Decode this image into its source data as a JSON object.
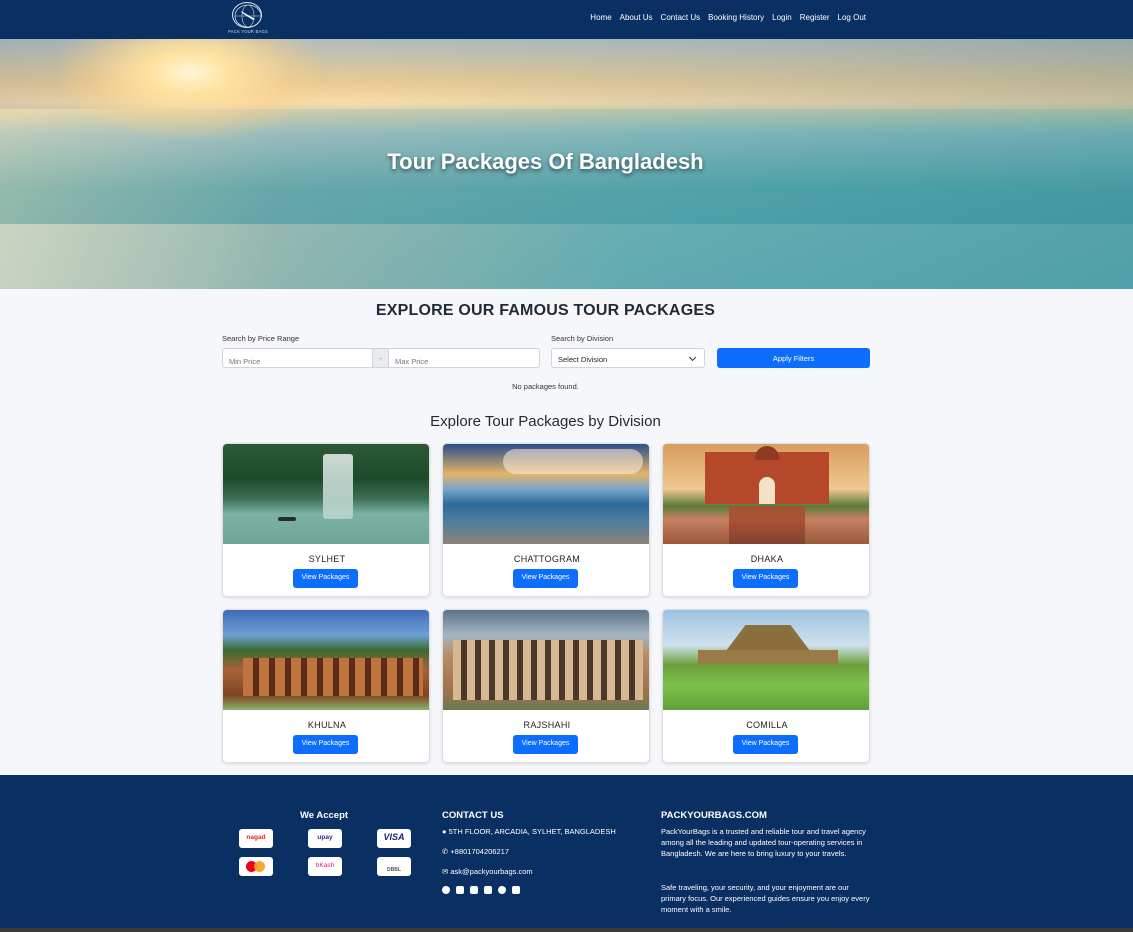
{
  "brand": {
    "logo_text": "PACK YOUR BAGS"
  },
  "nav": {
    "links": [
      "Home",
      "About Us",
      "Contact Us",
      "Booking History",
      "Login",
      "Register",
      "Log Out"
    ]
  },
  "hero": {
    "title": "Tour Packages Of Bangladesh"
  },
  "filters": {
    "heading": "EXPLORE OUR FAMOUS TOUR PACKAGES",
    "price_label": "Search by Price Range",
    "min_placeholder": "Min Price",
    "separator": "-",
    "max_placeholder": "Max Price",
    "division_label": "Search by Division",
    "division_selected": "Select Division",
    "apply_label": "Apply Filters",
    "empty_message": "No packages found."
  },
  "divisions": {
    "heading": "Explore Tour Packages by Division",
    "button_label": "View Packages",
    "items": [
      {
        "name": "SYLHET"
      },
      {
        "name": "CHATTOGRAM"
      },
      {
        "name": "DHAKA"
      },
      {
        "name": "KHULNA"
      },
      {
        "name": "RAJSHAHI"
      },
      {
        "name": "COMILLA"
      }
    ]
  },
  "footer": {
    "accept_heading": "We Accept",
    "payment_methods": [
      "nagad",
      "upay",
      "VISA",
      "mastercard",
      "bKash",
      "DBBL"
    ],
    "contact_heading": "CONTACT US",
    "address": "5TH FLOOR, ARCADIA, SYLHET, BANGLADESH",
    "phone": "+8801704206217",
    "email": "ask@packyourbags.com",
    "social_icons": [
      "facebook-icon",
      "twitter-icon",
      "linkedin-icon",
      "youtube-icon",
      "pinterest-icon",
      "instagram-icon"
    ],
    "about_heading": "PACKYOURBAGS.COM",
    "about_text_1": "PackYourBags is a trusted and reliable tour and travel agency among all the leading and updated tour-operating services in Bangladesh. We are here to bring luxury to your travels.",
    "about_text_2": "Safe traveling, your security, and your enjoyment are our primary focus. Our experienced guides ensure you enjoy every moment with a smile."
  },
  "colors": {
    "navy": "#0a2f63",
    "primary": "#0d6efd",
    "page_bg": "#f5f7fa"
  }
}
